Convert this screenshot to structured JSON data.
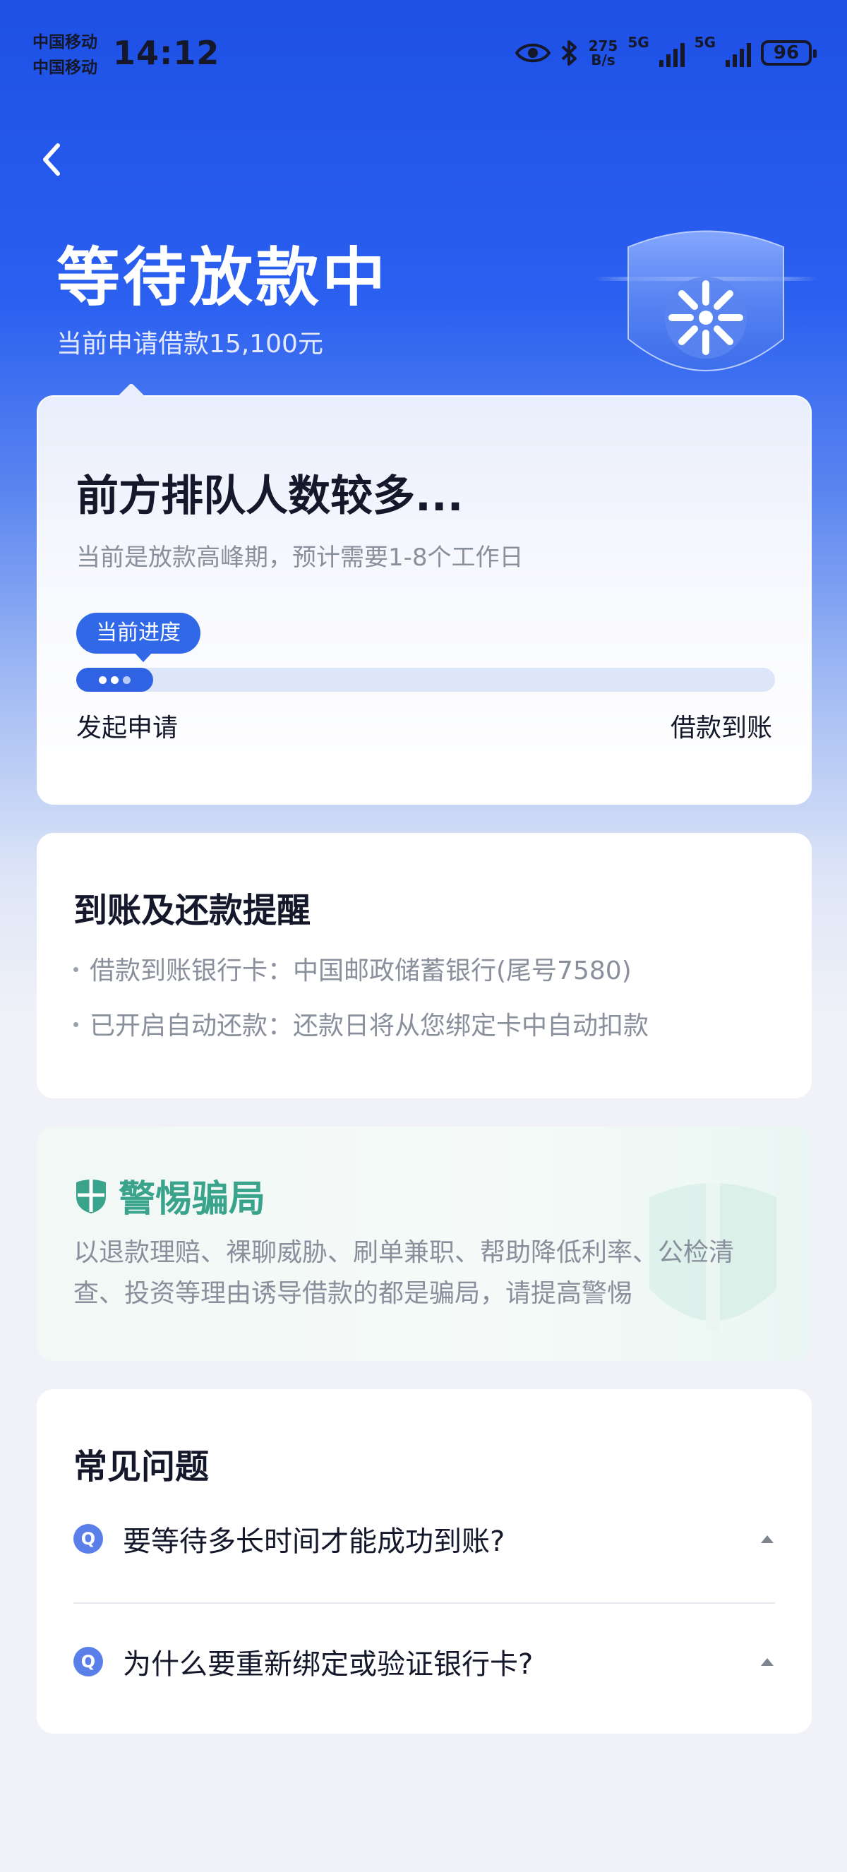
{
  "status_bar": {
    "carrier_1": "中国移动",
    "carrier_2": "中国移动",
    "time": "14:12",
    "net_speed_value": "275",
    "net_speed_unit": "B/s",
    "network_1": "5G",
    "network_2": "5G",
    "battery": "96"
  },
  "header": {
    "title": "等待放款中",
    "subtitle": "当前申请借款15,100元"
  },
  "progress_card": {
    "heading": "前方排队人数较多...",
    "description": "当前是放款高峰期，预计需要1-8个工作日",
    "badge": "当前进度",
    "progress": 0.11,
    "start_label": "发起申请",
    "end_label": "借款到账"
  },
  "reminder_card": {
    "heading": "到账及还款提醒",
    "items": [
      "借款到账银行卡：中国邮政储蓄银行(尾号7580)",
      "已开启自动还款：还款日将从您绑定卡中自动扣款"
    ]
  },
  "warning_card": {
    "heading": "警惕骗局",
    "text": "以退款理赔、裸聊威胁、刷单兼职、帮助降低利率、公检清查、投资等理由诱导借款的都是骗局，请提高警惕",
    "accent": "#3aa38b"
  },
  "faq_card": {
    "heading": "常见问题",
    "q_badge": "Q",
    "questions": [
      "要等待多长时间才能成功到账?",
      "为什么要重新绑定或验证银行卡?"
    ]
  },
  "colors": {
    "primary": "#2f63e3",
    "header_bg": "#1e50e6"
  }
}
